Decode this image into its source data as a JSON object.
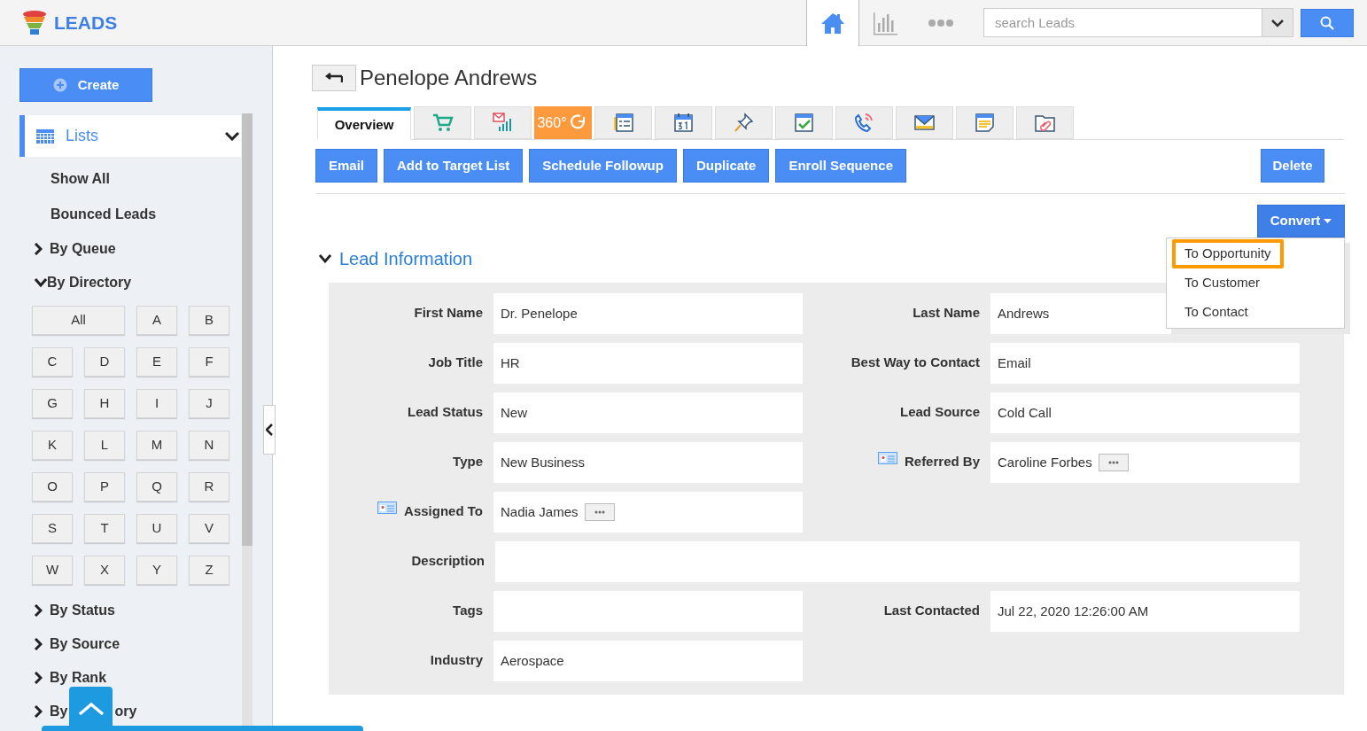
{
  "app": {
    "title": "LEADS"
  },
  "topbar": {
    "search": {
      "placeholder": "search Leads"
    }
  },
  "sidebar": {
    "create": "Create",
    "lists": {
      "label": "Lists",
      "expanded": true
    },
    "items": [
      {
        "kind": "link",
        "label": "Show All"
      },
      {
        "kind": "link",
        "label": "Bounced Leads"
      },
      {
        "kind": "group",
        "label": "By Queue",
        "expanded": false
      },
      {
        "kind": "group",
        "label": "By Directory",
        "expanded": true,
        "letters": [
          "All",
          "A",
          "B",
          "C",
          "D",
          "E",
          "F",
          "G",
          "H",
          "I",
          "J",
          "K",
          "L",
          "M",
          "N",
          "O",
          "P",
          "Q",
          "R",
          "S",
          "T",
          "U",
          "V",
          "W",
          "X",
          "Y",
          "Z"
        ]
      },
      {
        "kind": "group",
        "label": "By Status",
        "expanded": false
      },
      {
        "kind": "group",
        "label": "By Source",
        "expanded": false
      },
      {
        "kind": "group",
        "label": "By Rank",
        "expanded": false
      },
      {
        "kind": "group",
        "label": "By",
        "tail": "ory",
        "expanded": false
      }
    ]
  },
  "record": {
    "title": "Penelope Andrews",
    "tabs": [
      {
        "kind": "text",
        "label": "Overview",
        "selected": true
      },
      {
        "kind": "icon",
        "selected": false
      },
      {
        "kind": "icon",
        "selected": false
      },
      {
        "kind": "text",
        "label": "360°",
        "color": "#fd9a3d",
        "selected": false
      },
      {
        "kind": "icon",
        "selected": false
      },
      {
        "kind": "icon",
        "selected": false
      },
      {
        "kind": "icon",
        "selected": false
      },
      {
        "kind": "icon",
        "selected": false
      },
      {
        "kind": "icon",
        "selected": false
      },
      {
        "kind": "icon",
        "selected": false
      },
      {
        "kind": "icon",
        "selected": false
      },
      {
        "kind": "icon",
        "selected": false
      }
    ],
    "actions": [
      "Email",
      "Add to Target List",
      "Schedule Followup",
      "Duplicate",
      "Enroll Sequence"
    ],
    "delete": "Delete",
    "convert": {
      "label": "Convert",
      "menu": [
        {
          "label": "To Opportunity",
          "selected": true
        },
        {
          "label": "To Customer",
          "selected": false
        },
        {
          "label": "To Contact",
          "selected": false
        }
      ]
    },
    "section": {
      "title": "Lead Information",
      "expanded": true
    },
    "rows": [
      {
        "kind": "pair",
        "left": {
          "label": "First Name",
          "value": "Dr. Penelope"
        },
        "right": {
          "label": "Last Name",
          "value": "Andrews"
        }
      },
      {
        "kind": "pair",
        "left": {
          "label": "Job Title",
          "value": "HR"
        },
        "right": {
          "label": "Best Way to Contact",
          "value": "Email"
        }
      },
      {
        "kind": "pair",
        "left": {
          "label": "Lead Status",
          "value": "New"
        },
        "right": {
          "label": "Lead Source",
          "value": "Cold Call"
        }
      },
      {
        "kind": "pair",
        "left": {
          "label": "Type",
          "value": "New Business"
        },
        "right": {
          "label": "Referred By",
          "value": "Caroline Forbes",
          "lookup": true
        }
      },
      {
        "kind": "pair",
        "left": {
          "label": "Assigned To",
          "value": "Nadia James",
          "lookup": true
        }
      },
      {
        "kind": "wide",
        "left": {
          "label": "Description"
        }
      },
      {
        "kind": "pair",
        "left": {
          "label": "Tags"
        },
        "right": {
          "label": "Last Contacted",
          "value": "Jul 22, 2020 12:26:00 AM"
        }
      },
      {
        "kind": "pair",
        "left": {
          "label": "Industry",
          "value": "Aerospace"
        }
      }
    ]
  }
}
